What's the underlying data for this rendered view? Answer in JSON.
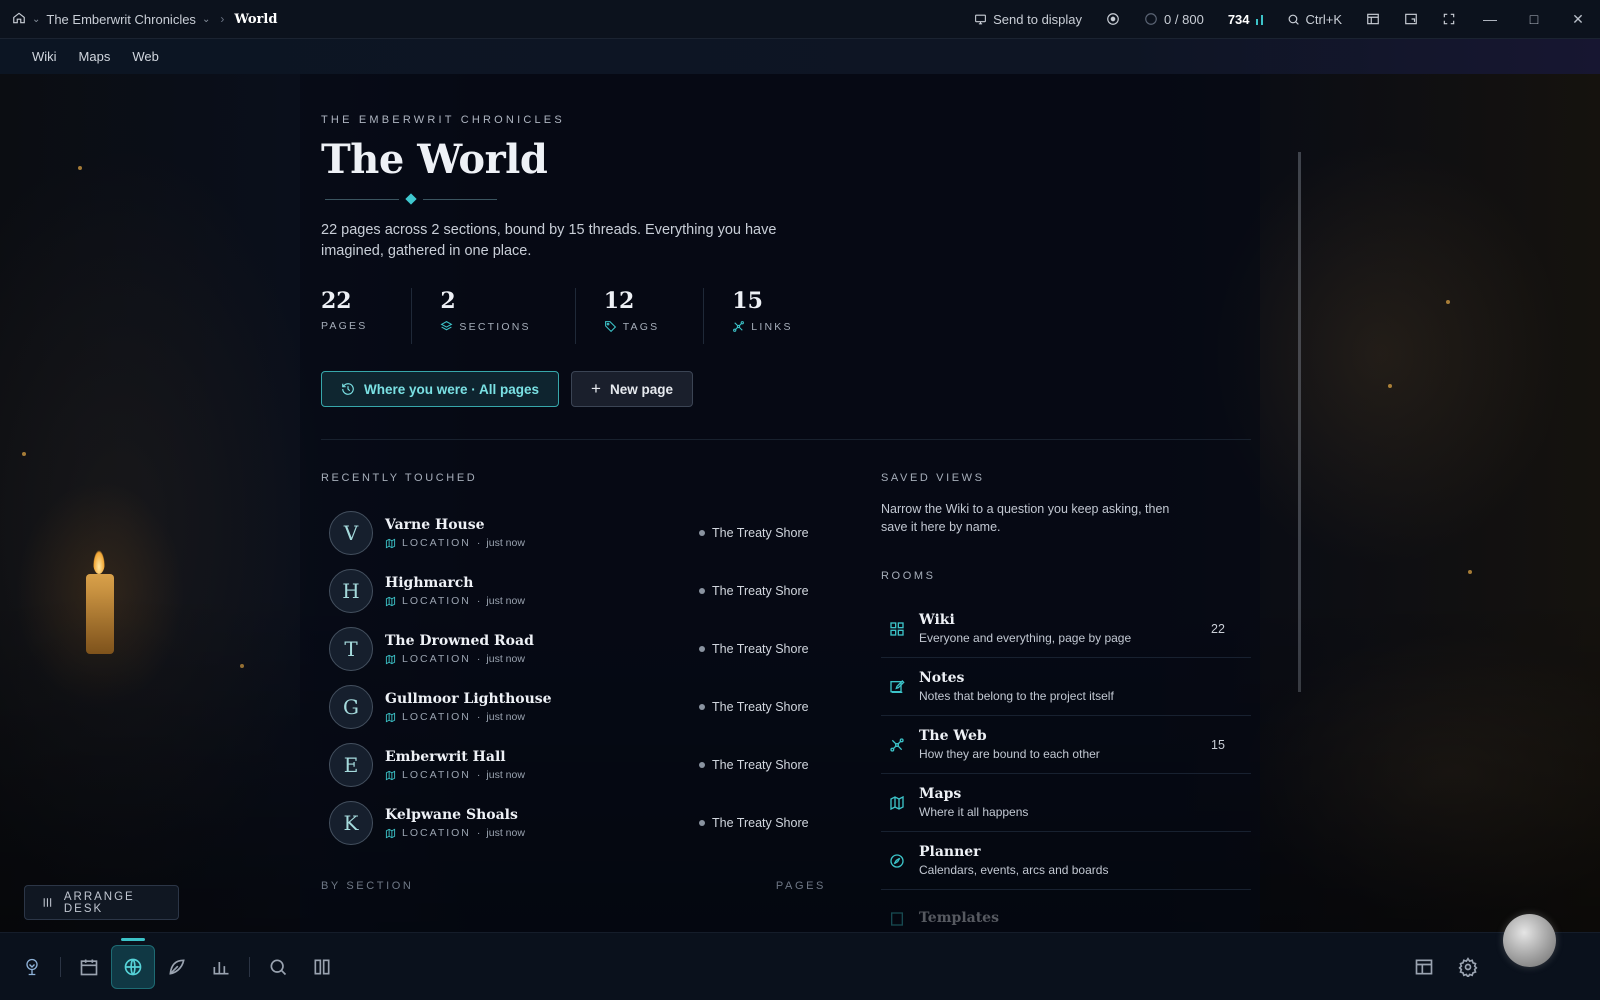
{
  "titlebar": {
    "project": "The Emberwrit Chronicles",
    "current": "World",
    "send_to_display": "Send to display",
    "word_progress": "0 / 800",
    "word_count": "734",
    "search_shortcut": "Ctrl+K"
  },
  "menu": [
    "Wiki",
    "Maps",
    "Web"
  ],
  "hero": {
    "eyebrow": "THE EMBERWRIT CHRONICLES",
    "title": "The World",
    "intro": "22 pages across 2 sections, bound by 15 threads. Everything you have imagined, gathered in one place."
  },
  "stats": [
    {
      "value": "22",
      "label": "PAGES",
      "icon": ""
    },
    {
      "value": "2",
      "label": "SECTIONS",
      "icon": "layers-icon"
    },
    {
      "value": "12",
      "label": "TAGS",
      "icon": "tag-icon"
    },
    {
      "value": "15",
      "label": "LINKS",
      "icon": "link-icon"
    }
  ],
  "actions": {
    "primary": "Where you were · All pages",
    "secondary": "New page"
  },
  "recent": {
    "title": "RECENTLY TOUCHED",
    "items": [
      {
        "initial": "V",
        "name": "Varne House",
        "kind": "LOCATION",
        "time": "just now",
        "section": "The Treaty Shore"
      },
      {
        "initial": "H",
        "name": "Highmarch",
        "kind": "LOCATION",
        "time": "just now",
        "section": "The Treaty Shore"
      },
      {
        "initial": "T",
        "name": "The Drowned Road",
        "kind": "LOCATION",
        "time": "just now",
        "section": "The Treaty Shore"
      },
      {
        "initial": "G",
        "name": "Gullmoor Lighthouse",
        "kind": "LOCATION",
        "time": "just now",
        "section": "The Treaty Shore"
      },
      {
        "initial": "E",
        "name": "Emberwrit Hall",
        "kind": "LOCATION",
        "time": "just now",
        "section": "The Treaty Shore"
      },
      {
        "initial": "K",
        "name": "Kelpwane Shoals",
        "kind": "LOCATION",
        "time": "just now",
        "section": "The Treaty Shore"
      }
    ]
  },
  "by_section": {
    "title": "BY SECTION",
    "col": "PAGES"
  },
  "saved_views": {
    "title": "SAVED VIEWS",
    "desc": "Narrow the Wiki to a question you keep asking, then save it here by name."
  },
  "rooms": {
    "title": "ROOMS",
    "items": [
      {
        "name": "Wiki",
        "desc": "Everyone and everything, page by page",
        "count": "22",
        "icon": "grid-icon"
      },
      {
        "name": "Notes",
        "desc": "Notes that belong to the project itself",
        "count": "",
        "icon": "edit-icon"
      },
      {
        "name": "The Web",
        "desc": "How they are bound to each other",
        "count": "15",
        "icon": "link-icon"
      },
      {
        "name": "Maps",
        "desc": "Where it all happens",
        "count": "",
        "icon": "map-icon"
      },
      {
        "name": "Planner",
        "desc": "Calendars, events, arcs and boards",
        "count": "",
        "icon": "compass-icon"
      },
      {
        "name": "Templates",
        "desc": "",
        "count": "",
        "icon": "template-icon"
      }
    ]
  },
  "arrange_desk": "ARRANGE DESK",
  "colors": {
    "accent": "#3cc3c8",
    "bg": "#070b14"
  }
}
